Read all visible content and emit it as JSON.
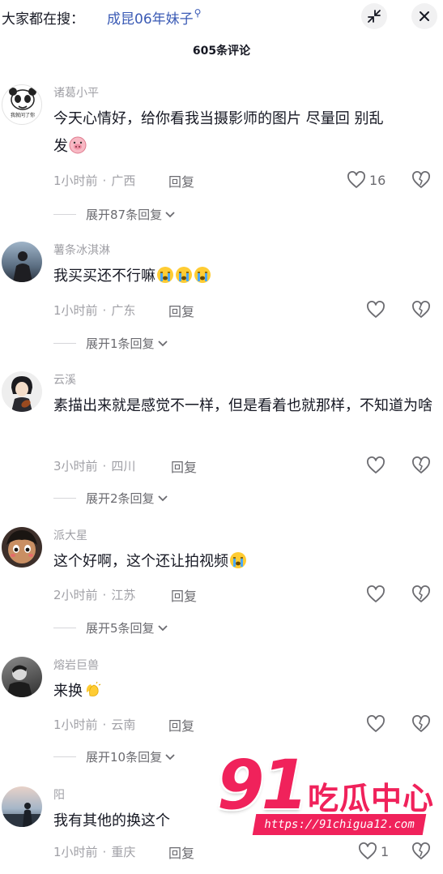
{
  "search": {
    "prefix": "大家都在搜：",
    "term": "成昆06年妹子",
    "search_glyph": "⚲"
  },
  "header": {
    "comment_count": "605条评论"
  },
  "icons": {
    "collapse": "collapse-arrows-icon",
    "close": "close-icon",
    "like": "heart-outline-icon",
    "dislike": "broken-heart-icon",
    "expand": "chevron-down-icon"
  },
  "colors": {
    "accent_link": "#3b5bb5",
    "watermark": "#f0225b",
    "muted_text": "#a0a0a6"
  },
  "comments": [
    {
      "username": "诸葛小平",
      "avatar_badge": "我就问了你",
      "content": "今天心情好，给你看我当摄影师的图片 尽量回 别乱发",
      "emoji": "pig-face-emoji",
      "time": "1小时前",
      "location": "广西",
      "reply_label": "回复",
      "likes": "16",
      "expand_label": "展开87条回复"
    },
    {
      "username": "薯条冰淇淋",
      "content": "我买买还不行嘛",
      "emoji": "crying-face-emoji x3",
      "time": "1小时前",
      "location": "广东",
      "reply_label": "回复",
      "likes": "",
      "expand_label": "展开1条回复"
    },
    {
      "username": "云溪",
      "content": "素描出来就是感觉不一样，但是看着也就那样，不知道为啥",
      "time": "3小时前",
      "location": "四川",
      "reply_label": "回复",
      "likes": "",
      "expand_label": "展开2条回复"
    },
    {
      "username": "派大星",
      "content": "这个好啊，这个还让拍视频",
      "emoji": "crying-face-emoji",
      "time": "2小时前",
      "location": "江苏",
      "reply_label": "回复",
      "likes": "",
      "expand_label": "展开5条回复"
    },
    {
      "username": "熔岩巨兽",
      "content": "来换",
      "emoji": "clapping-hands-emoji",
      "time": "1小时前",
      "location": "云南",
      "reply_label": "回复",
      "likes": "",
      "expand_label": "展开10条回复"
    },
    {
      "username": "阳",
      "content": "我有其他的换这个",
      "time": "1小时前",
      "location": "重庆",
      "reply_label": "回复",
      "likes": "1",
      "expand_label": ""
    }
  ],
  "watermark": {
    "number": "91",
    "name": "吃瓜中心",
    "url": "https://91chigua12.com"
  }
}
